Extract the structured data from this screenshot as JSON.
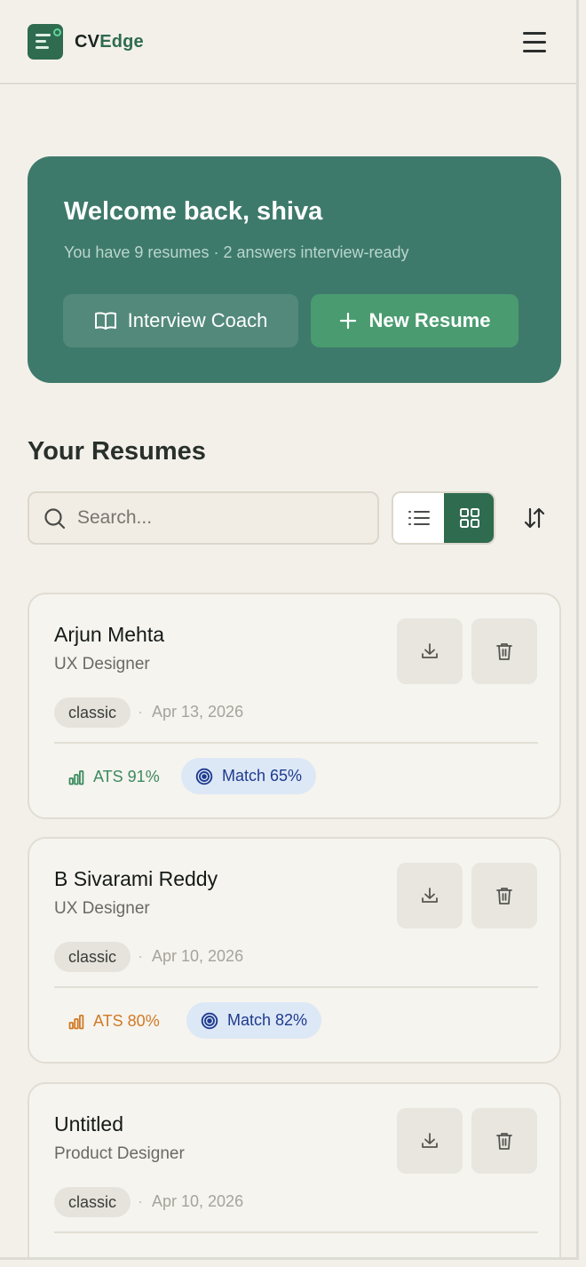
{
  "header": {
    "brand_part1": "CV",
    "brand_part2": "Edge",
    "menu_icon": "hamburger-menu-icon"
  },
  "hero": {
    "title": "Welcome back, shiva",
    "subtitle": "You have 9 resumes · 2 answers interview-ready",
    "coach_button": "Interview Coach",
    "new_button": "New Resume"
  },
  "resumes": {
    "section_title": "Your Resumes",
    "search_placeholder": "Search...",
    "view_modes": [
      "list",
      "grid"
    ],
    "active_view": "grid",
    "items": [
      {
        "name": "Arjun Mehta",
        "role": "UX Designer",
        "template": "classic",
        "date": "Apr 13, 2026",
        "ats": "ATS 91%",
        "ats_color": "#3b8a5e",
        "match": "Match 65%"
      },
      {
        "name": "B Sivarami Reddy",
        "role": "UX Designer",
        "template": "classic",
        "date": "Apr 10, 2026",
        "ats": "ATS 80%",
        "ats_color": "#d07a25",
        "match": "Match 82%"
      },
      {
        "name": "Untitled",
        "role": "Product Designer",
        "template": "classic",
        "date": "Apr 10, 2026",
        "ats": "",
        "ats_color": "#3b8a5e",
        "match": ""
      }
    ]
  },
  "colors": {
    "brand": "#2f6b4f",
    "hero_bg": "#3e7a6b",
    "new_button": "#4a9b70",
    "match_bg": "#dde8f6",
    "match_text": "#1f3b8f"
  }
}
